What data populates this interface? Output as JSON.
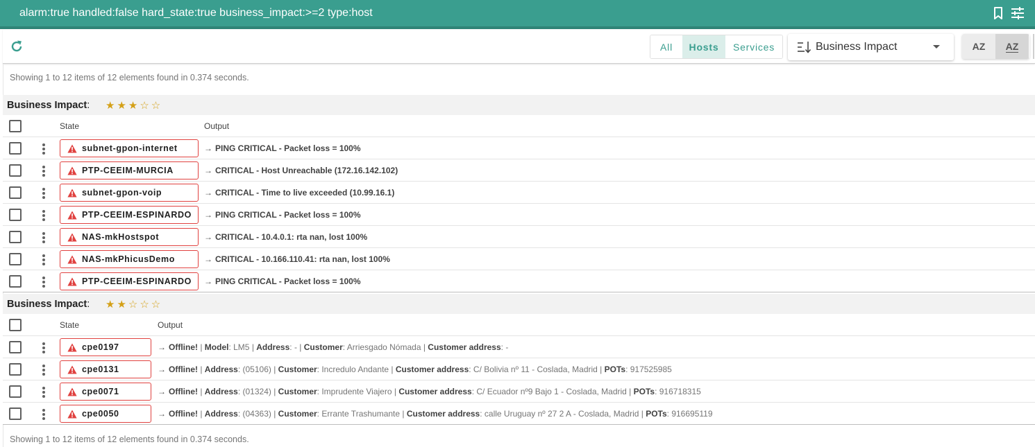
{
  "search": {
    "query": "alarm:true handled:false hard_state:true business_impact:>=2 type:host",
    "icons": [
      "bookmark-icon",
      "tune-icon"
    ]
  },
  "toolbar": {
    "refresh_icon": "refresh-icon",
    "filter_tabs": [
      {
        "label": "All",
        "active": false
      },
      {
        "label": "Hosts",
        "active": true
      },
      {
        "label": "Services",
        "active": false
      }
    ],
    "sort_field": "Business Impact",
    "sort_icon": "sort-icon",
    "sort_order_buttons": [
      {
        "label": "AZ",
        "direction": "ascending",
        "active": false
      },
      {
        "label": "AZ",
        "direction": "descending",
        "active": true
      }
    ]
  },
  "summary_top": "Showing 1 to 12 items of 12 elements found in 0.374 seconds.",
  "summary_bottom": "Showing 1 to 12 items of 12 elements found in 0.374 seconds.",
  "colors": {
    "accent": "#3a9e8f",
    "critical": "#e0413f",
    "star": "#d4a017"
  },
  "groups": [
    {
      "label": "Business Impact",
      "stars": "★★★☆☆",
      "rating": 3,
      "columns": {
        "state": "State",
        "output": "Output"
      },
      "rows": [
        {
          "name": "subnet-gpon-internet",
          "state_icon": "warning-icon",
          "output": [
            {
              "t": "PING CRITICAL - Packet loss = 100%",
              "b": true
            }
          ]
        },
        {
          "name": "PTP-CEEIM-MURCIA",
          "state_icon": "warning-icon",
          "output": [
            {
              "t": "CRITICAL - Host Unreachable (172.16.142.102)",
              "b": true
            }
          ]
        },
        {
          "name": "subnet-gpon-voip",
          "state_icon": "warning-icon",
          "output": [
            {
              "t": "CRITICAL - Time to live exceeded (10.99.16.1)",
              "b": true
            }
          ]
        },
        {
          "name": "PTP-CEEIM-ESPINARDO",
          "state_icon": "warning-icon",
          "output": [
            {
              "t": "PING CRITICAL - Packet loss = 100%",
              "b": true
            }
          ]
        },
        {
          "name": "NAS-mkHostspot",
          "state_icon": "warning-icon",
          "output": [
            {
              "t": "CRITICAL - 10.4.0.1: rta nan, lost 100%",
              "b": true
            }
          ]
        },
        {
          "name": "NAS-mkPhicusDemo",
          "state_icon": "warning-icon",
          "output": [
            {
              "t": "CRITICAL - 10.166.110.41: rta nan, lost 100%",
              "b": true
            }
          ]
        },
        {
          "name": "PTP-CEEIM-ESPINARDO",
          "state_icon": "warning-icon",
          "output": [
            {
              "t": "PING CRITICAL - Packet loss = 100%",
              "b": true
            }
          ]
        }
      ]
    },
    {
      "label": "Business Impact",
      "stars": "★★☆☆☆",
      "rating": 2,
      "columns": {
        "state": "State",
        "output": "Output"
      },
      "rows": [
        {
          "name": "cpe0197",
          "state_icon": "warning-icon",
          "output": [
            {
              "t": "Offline!",
              "b": true
            },
            {
              "t": " | ",
              "b": false
            },
            {
              "t": "Model",
              "b": true
            },
            {
              "t": ": LM5 | ",
              "b": false
            },
            {
              "t": "Address",
              "b": true
            },
            {
              "t": ": - | ",
              "b": false
            },
            {
              "t": "Customer",
              "b": true
            },
            {
              "t": ": Arriesgado Nómada | ",
              "b": false
            },
            {
              "t": "Customer address",
              "b": true
            },
            {
              "t": ": -",
              "b": false
            }
          ]
        },
        {
          "name": "cpe0131",
          "state_icon": "warning-icon",
          "output": [
            {
              "t": "Offline!",
              "b": true
            },
            {
              "t": " | ",
              "b": false
            },
            {
              "t": "Address",
              "b": true
            },
            {
              "t": ": (05106) | ",
              "b": false
            },
            {
              "t": "Customer",
              "b": true
            },
            {
              "t": ": Incredulo Andante | ",
              "b": false
            },
            {
              "t": "Customer address",
              "b": true
            },
            {
              "t": ": C/ Bolivia nº 11 - Coslada, Madrid | ",
              "b": false
            },
            {
              "t": "POTs",
              "b": true
            },
            {
              "t": ": 917525985",
              "b": false
            }
          ]
        },
        {
          "name": "cpe0071",
          "state_icon": "warning-icon",
          "output": [
            {
              "t": "Offline!",
              "b": true
            },
            {
              "t": " | ",
              "b": false
            },
            {
              "t": "Address",
              "b": true
            },
            {
              "t": ": (01324) | ",
              "b": false
            },
            {
              "t": "Customer",
              "b": true
            },
            {
              "t": ": Imprudente Viajero | ",
              "b": false
            },
            {
              "t": "Customer address",
              "b": true
            },
            {
              "t": ": C/ Ecuador nº9 Bajo 1 - Coslada, Madrid | ",
              "b": false
            },
            {
              "t": "POTs",
              "b": true
            },
            {
              "t": ": 916718315",
              "b": false
            }
          ]
        },
        {
          "name": "cpe0050",
          "state_icon": "warning-icon",
          "output": [
            {
              "t": "Offline!",
              "b": true
            },
            {
              "t": " | ",
              "b": false
            },
            {
              "t": "Address",
              "b": true
            },
            {
              "t": ": (04363) | ",
              "b": false
            },
            {
              "t": "Customer",
              "b": true
            },
            {
              "t": ": Errante Trashumante | ",
              "b": false
            },
            {
              "t": "Customer address",
              "b": true
            },
            {
              "t": ": calle Uruguay nº 27 2 A - Coslada, Madrid | ",
              "b": false
            },
            {
              "t": "POTs",
              "b": true
            },
            {
              "t": ": 916695119",
              "b": false
            }
          ]
        }
      ]
    }
  ]
}
